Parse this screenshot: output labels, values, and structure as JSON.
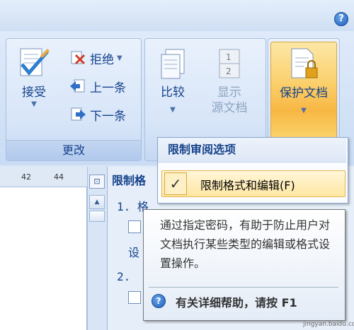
{
  "ribbon": {
    "help_glyph": "?",
    "review_group": {
      "accept_label": "接受",
      "reject_label": "拒绝",
      "previous_label": "上一条",
      "next_label": "下一条",
      "group_label": "更改"
    },
    "compare_group": {
      "compare_label": "比较",
      "show_source_line1": "显示",
      "show_source_line2": "源文档"
    },
    "protect_group": {
      "protect_label": "保护文档"
    }
  },
  "ruler": {
    "marks": [
      "42",
      "44"
    ]
  },
  "pane": {
    "title": "限制格",
    "section1": "1. 格",
    "setting_text": "设",
    "section2": "2. "
  },
  "menu": {
    "header": "限制审阅选项",
    "item_check": "✓",
    "item_label": "限制格式和编辑(F)"
  },
  "tooltip": {
    "description": "通过指定密码，有助于防止用户对文档执行某些类型的编辑或格式设置操作。",
    "help_text": "有关详细帮助，请按 F1",
    "help_glyph": "?"
  },
  "watermark": "jingyan.baidu.com",
  "colors": {
    "ribbon_text": "#15428b",
    "highlight": "#fbd16f"
  }
}
